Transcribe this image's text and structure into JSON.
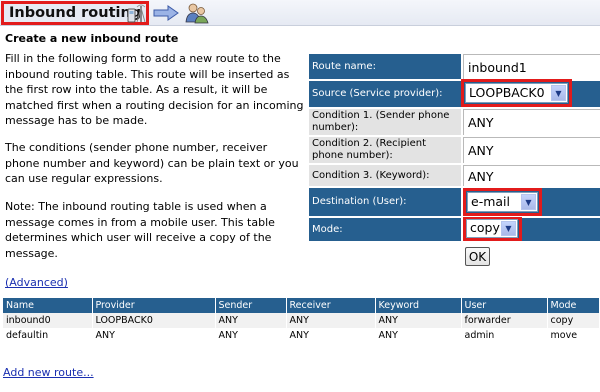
{
  "page": {
    "title": "Inbound routing",
    "section_title": "Create a new inbound route",
    "desc1": [
      "Fill in the following form to add a new route to the",
      "inbound routing table. This route will be inserted as",
      "the first row into the table. As a result, it will be",
      "matched first when a routing decision for an incoming",
      "message has to be made."
    ],
    "desc2": [
      "The conditions (sender phone number, receiver",
      "phone number and keyword) can be plain text or you",
      "can use regular expressions."
    ],
    "desc3": [
      "Note: The inbound routing table is used when a",
      "message comes in from a mobile user. This table",
      "determines which user will receive a copy of the",
      "message."
    ],
    "advanced_link": "(Advanced)",
    "add_link": "Add new route..."
  },
  "header_icons": [
    "phone-tower-icon",
    "arrow-right-icon",
    "users-icon"
  ],
  "colors": {
    "accent": "#265f8f",
    "highlight": "#e21b1b",
    "link": "#1a2fb0"
  },
  "form": {
    "route_name_label": "Route name:",
    "route_name_value": "inbound1",
    "source_label": "Source (Service provider):",
    "source_value": "LOOPBACK0",
    "cond1_label": "Condition 1. (Sender phone number):",
    "cond1_value": "ANY",
    "cond2_label": "Condition 2. (Recipient phone number):",
    "cond2_value": "ANY",
    "cond3_label": "Condition 3. (Keyword):",
    "cond3_value": "ANY",
    "dest_label": "Destination (User):",
    "dest_value": "e-mail",
    "mode_label": "Mode:",
    "mode_value": "copy",
    "ok_label": "OK"
  },
  "table": {
    "headers": [
      "Name",
      "Provider",
      "Sender",
      "Receiver",
      "Keyword",
      "User",
      "Mode"
    ],
    "rows": [
      [
        "inbound0",
        "LOOPBACK0",
        "ANY",
        "ANY",
        "ANY",
        "forwarder",
        "copy"
      ],
      [
        "defaultin",
        "ANY",
        "ANY",
        "ANY",
        "ANY",
        "admin",
        "move"
      ]
    ]
  }
}
